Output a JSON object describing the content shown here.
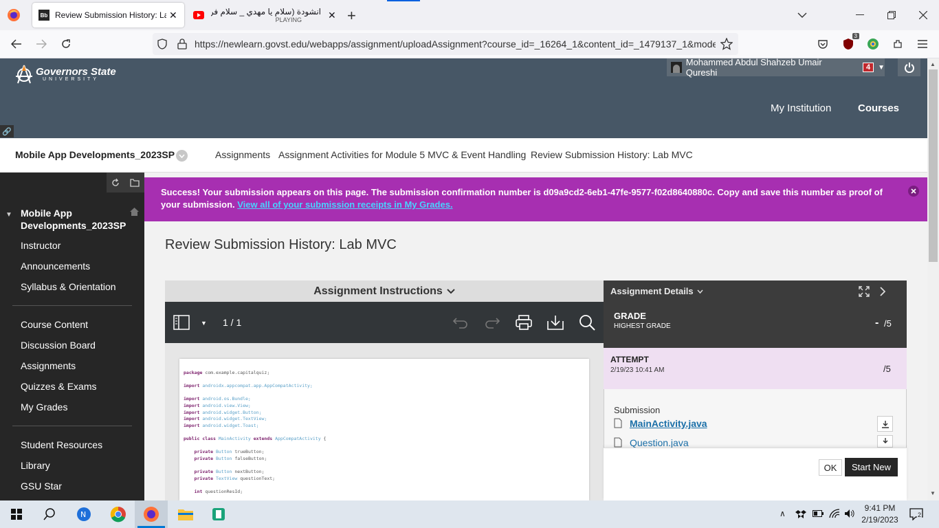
{
  "browser": {
    "tabs": [
      {
        "title": "Review Submission History: Lab",
        "favicon": "blackboard-icon"
      },
      {
        "title": "انشودة (سلام يا مهدي _ سلام فرد",
        "subtitle": "PLAYING",
        "favicon": "youtube-icon"
      }
    ],
    "url": "https://newlearn.govst.edu/webapps/assignment/uploadAssignment?course_id=_16264_1&content_id=_1479137_1&mode",
    "extension_badge": "3"
  },
  "header": {
    "logo_text": "Governors State",
    "logo_sub": "UNIVERSITY",
    "user_name": "Mohammed Abdul Shahzeb Umair Qureshi",
    "notification_count": "4",
    "nav": {
      "institution": "My Institution",
      "courses": "Courses"
    }
  },
  "breadcrumb": {
    "course": "Mobile App Developments_2023SP",
    "items": [
      "Assignments",
      "Assignment Activities for Module 5 MVC & Event Handling",
      "Review Submission History: Lab MVC"
    ]
  },
  "sidebar": {
    "course_title": "Mobile App Developments_2023SP",
    "group1": [
      "Instructor",
      "Announcements",
      "Syllabus & Orientation"
    ],
    "group2": [
      "Course Content",
      "Discussion Board",
      "Assignments",
      "Quizzes & Exams",
      "My Grades"
    ],
    "group3": [
      "Student Resources",
      "Library",
      "GSU Star"
    ]
  },
  "banner": {
    "text": "Success! Your submission appears on this page. The submission confirmation number is d09a9cd2-6eb1-47fe-9577-f02d8640880c. Copy and save this number as proof of your submission. ",
    "link": "View all of your submission receipts in My Grades."
  },
  "page": {
    "title": "Review Submission History: Lab MVC",
    "instructions_label": "Assignment Instructions",
    "pdf_page": "1 / 1"
  },
  "code_lines": [
    [
      [
        "kw",
        "package"
      ],
      [
        "",
        " com.example.capitalquiz;"
      ]
    ],
    [],
    [
      [
        "kw",
        "import"
      ],
      [
        "ty",
        " androidx.appcompat.app.AppCompatActivity;"
      ]
    ],
    [],
    [
      [
        "kw",
        "import"
      ],
      [
        "ty",
        " android.os.Bundle;"
      ]
    ],
    [
      [
        "kw",
        "import"
      ],
      [
        "ty",
        " android.view.View;"
      ]
    ],
    [
      [
        "kw",
        "import"
      ],
      [
        "ty",
        " android.widget.Button;"
      ]
    ],
    [
      [
        "kw",
        "import"
      ],
      [
        "ty",
        " android.widget.TextView;"
      ]
    ],
    [
      [
        "kw",
        "import"
      ],
      [
        "ty",
        " android.widget.Toast;"
      ]
    ],
    [],
    [
      [
        "kw",
        "public class"
      ],
      [
        "ty",
        " MainActivity "
      ],
      [
        "kw",
        "extends"
      ],
      [
        "ty",
        " AppCompatActivity"
      ],
      [
        "",
        " {"
      ]
    ],
    [],
    [
      [
        "",
        "    "
      ],
      [
        "kw",
        "private"
      ],
      [
        "ty",
        " Button"
      ],
      [
        "",
        " trueButton;"
      ]
    ],
    [
      [
        "",
        "    "
      ],
      [
        "kw",
        "private"
      ],
      [
        "ty",
        " Button"
      ],
      [
        "",
        " falseButton;"
      ]
    ],
    [],
    [
      [
        "",
        "    "
      ],
      [
        "kw",
        "private"
      ],
      [
        "ty",
        " Button"
      ],
      [
        "",
        " nextButton;"
      ]
    ],
    [
      [
        "",
        "    "
      ],
      [
        "kw",
        "private"
      ],
      [
        "ty",
        " TextView"
      ],
      [
        "",
        " questionText;"
      ]
    ],
    [],
    [
      [
        "",
        "    "
      ],
      [
        "kw",
        "int"
      ],
      [
        "",
        " questionResId;"
      ]
    ]
  ],
  "details": {
    "header": "Assignment Details",
    "grade_label": "GRADE",
    "grade_sub": "HIGHEST GRADE",
    "grade_value": "-",
    "grade_total": "/5",
    "attempt_label": "ATTEMPT",
    "attempt_date": "2/19/23 10:41 AM",
    "attempt_total": "/5",
    "submission_label": "Submission",
    "files": [
      "MainActivity.java",
      "Question.java"
    ],
    "ok_label": "OK",
    "start_new_label": "Start New"
  },
  "taskbar": {
    "time": "9:41 PM",
    "date": "2/19/2023",
    "notifications": "2"
  },
  "colors": {
    "banner": "#a72fb1",
    "header": "#475766",
    "sidebar": "#262626",
    "link": "#1a6fa8"
  }
}
